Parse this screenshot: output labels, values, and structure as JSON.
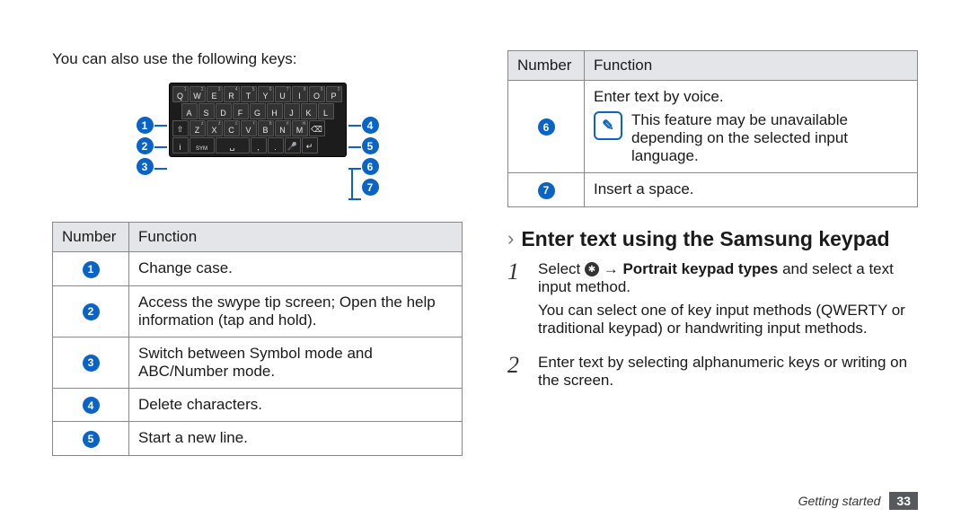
{
  "left": {
    "intro": "You can also use the following keys:",
    "keyboard": {
      "rows": [
        [
          "Q",
          "W",
          "E",
          "R",
          "T",
          "Y",
          "U",
          "I",
          "O",
          "P"
        ],
        [
          "A",
          "S",
          "D",
          "F",
          "G",
          "H",
          "J",
          "K",
          "L"
        ],
        [
          "⇧",
          "Z",
          "X",
          "C",
          "V",
          "B",
          "N",
          "M",
          "⌫"
        ]
      ],
      "row3_sup": [
        null,
        "ż",
        "ź",
        "ć",
        "ŕ",
        "ḃ",
        "ń",
        "ḿ",
        null
      ],
      "row1_sup": [
        "1",
        "2",
        "3",
        "4",
        "5",
        "6",
        "7",
        "8",
        "9",
        "0"
      ],
      "bottom": [
        "i",
        "SYM",
        "␣",
        ",",
        ".",
        "🎤",
        "↵"
      ]
    },
    "badges_left": [
      "1",
      "2",
      "3"
    ],
    "badges_right": [
      "4",
      "5",
      "6",
      "7"
    ],
    "table": {
      "head": [
        "Number",
        "Function"
      ],
      "rows": [
        {
          "n": "1",
          "f": "Change case."
        },
        {
          "n": "2",
          "f": "Access the swype tip screen; Open the help information (tap and hold)."
        },
        {
          "n": "3",
          "f": "Switch between Symbol mode and ABC/Number mode."
        },
        {
          "n": "4",
          "f": "Delete characters."
        },
        {
          "n": "5",
          "f": "Start a new line."
        }
      ]
    }
  },
  "right": {
    "table": {
      "head": [
        "Number",
        "Function"
      ],
      "rows": [
        {
          "n": "6",
          "f_lead": "Enter text by voice.",
          "note": "This feature may be unavailable depending on the selected input language."
        },
        {
          "n": "7",
          "f": "Insert a space."
        }
      ]
    },
    "section_arrow": "›",
    "section_title": "Enter text using the Samsung keypad",
    "steps": [
      {
        "n": "1",
        "pre": "Select ",
        "icon": "✱",
        "mid": " → ",
        "bold": "Portrait keypad types",
        "post": " and select a text input method.",
        "sub": "You can select one of key input methods (QWERTY or traditional keypad) or handwriting input methods."
      },
      {
        "n": "2",
        "text": "Enter text by selecting alphanumeric keys or writing on the screen."
      }
    ]
  },
  "footer": {
    "section": "Getting started",
    "page": "33"
  }
}
